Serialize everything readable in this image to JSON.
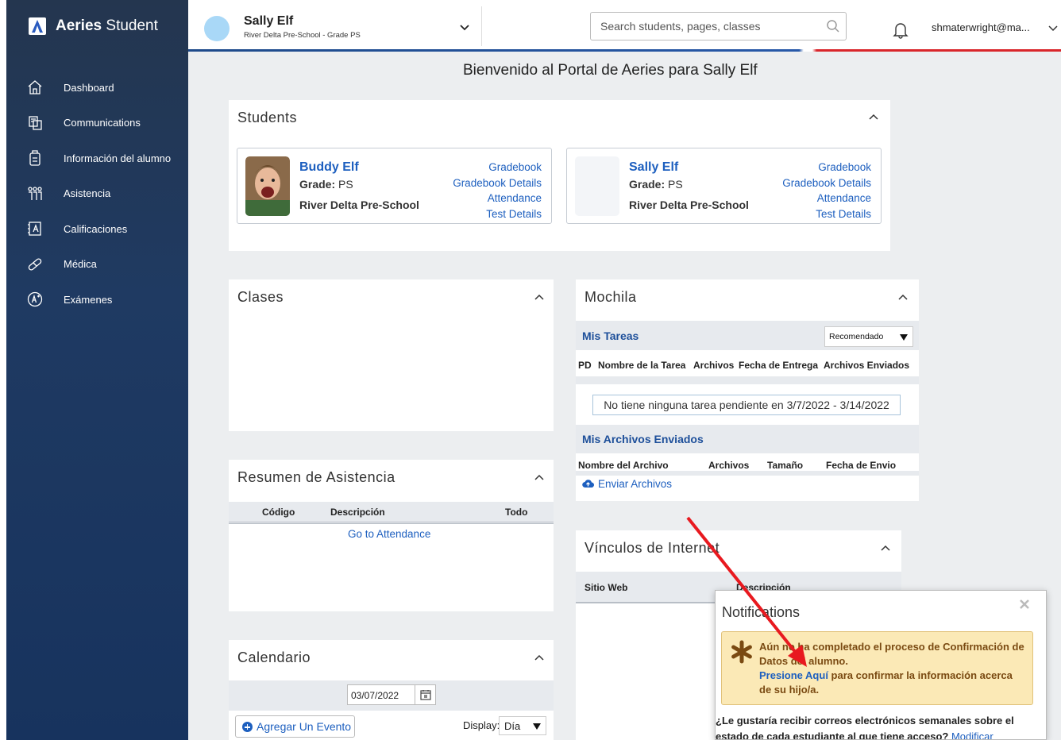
{
  "app": {
    "brand_bold": "Aeries",
    "brand_light": "Student"
  },
  "sidebar": {
    "items": [
      {
        "label": "Dashboard",
        "icon": "dashboard-icon"
      },
      {
        "label": "Communications",
        "icon": "communications-icon"
      },
      {
        "label": "Información del alumno",
        "icon": "student-info-icon"
      },
      {
        "label": "Asistencia",
        "icon": "attendance-icon"
      },
      {
        "label": "Calificaciones",
        "icon": "grades-icon"
      },
      {
        "label": "Médica",
        "icon": "medical-icon"
      },
      {
        "label": "Exámenes",
        "icon": "tests-icon"
      }
    ]
  },
  "header": {
    "student_name": "Sally Elf",
    "student_school": "River Delta Pre-School - Grade PS",
    "search_placeholder": "Search students, pages, classes",
    "user": "shmaterwright@ma..."
  },
  "welcome": "Bienvenido al Portal de Aeries para Sally Elf",
  "students": {
    "title": "Students",
    "cards": [
      {
        "name": "Buddy Elf",
        "grade_label": "Grade:",
        "grade": "PS",
        "school": "River Delta Pre-School",
        "links": [
          "Gradebook",
          "Gradebook Details",
          "Attendance",
          "Test Details"
        ]
      },
      {
        "name": "Sally Elf",
        "grade_label": "Grade:",
        "grade": "PS",
        "school": "River Delta Pre-School",
        "links": [
          "Gradebook",
          "Gradebook Details",
          "Attendance",
          "Test Details"
        ]
      }
    ]
  },
  "clases": {
    "title": "Clases"
  },
  "mochila": {
    "title": "Mochila",
    "tareas_title": "Mis Tareas",
    "filter": "Recomendado",
    "tareas_columns": [
      "PD",
      "Nombre de la Tarea",
      "Archivos",
      "Fecha de Entrega",
      "Archivos Enviados"
    ],
    "empty_message": "No tiene ninguna tarea pendiente en 3/7/2022 - 3/14/2022",
    "archivos_title": "Mis Archivos Enviados",
    "archivos_columns": [
      "Nombre del Archivo",
      "Archivos",
      "Tamaño",
      "Fecha de Envio"
    ],
    "upload_link": "Enviar Archivos"
  },
  "asistencia": {
    "title": "Resumen de Asistencia",
    "columns": [
      "Código",
      "Descripción",
      "Todo"
    ],
    "link": "Go to Attendance"
  },
  "vinculos": {
    "title": "Vínculos de Internet",
    "columns": [
      "Sitio Web",
      "Descripción"
    ]
  },
  "calendario": {
    "title": "Calendario",
    "date": "03/07/2022",
    "add_event": "Agregar Un Evento",
    "display_label": "Display:",
    "display_value": "Día"
  },
  "notifications": {
    "title": "Notifications",
    "alert_text": "Aún no ha completado el proceso de Confirmación de Datos del alumno.",
    "alert_link": "Presione Aquí",
    "alert_rest": " para confirmar la información acerca de su hijo/a.",
    "question": "¿Le gustaría recibir correos electrónicos semanales sobre el estado de cada estudiante al que tiene acceso?",
    "modify_link": "Modificar"
  },
  "colors": {
    "sidebar": "#1f3a62",
    "link": "#1d5fbf",
    "alert_bg": "#fbe9b6",
    "arrow": "#e8191f"
  }
}
